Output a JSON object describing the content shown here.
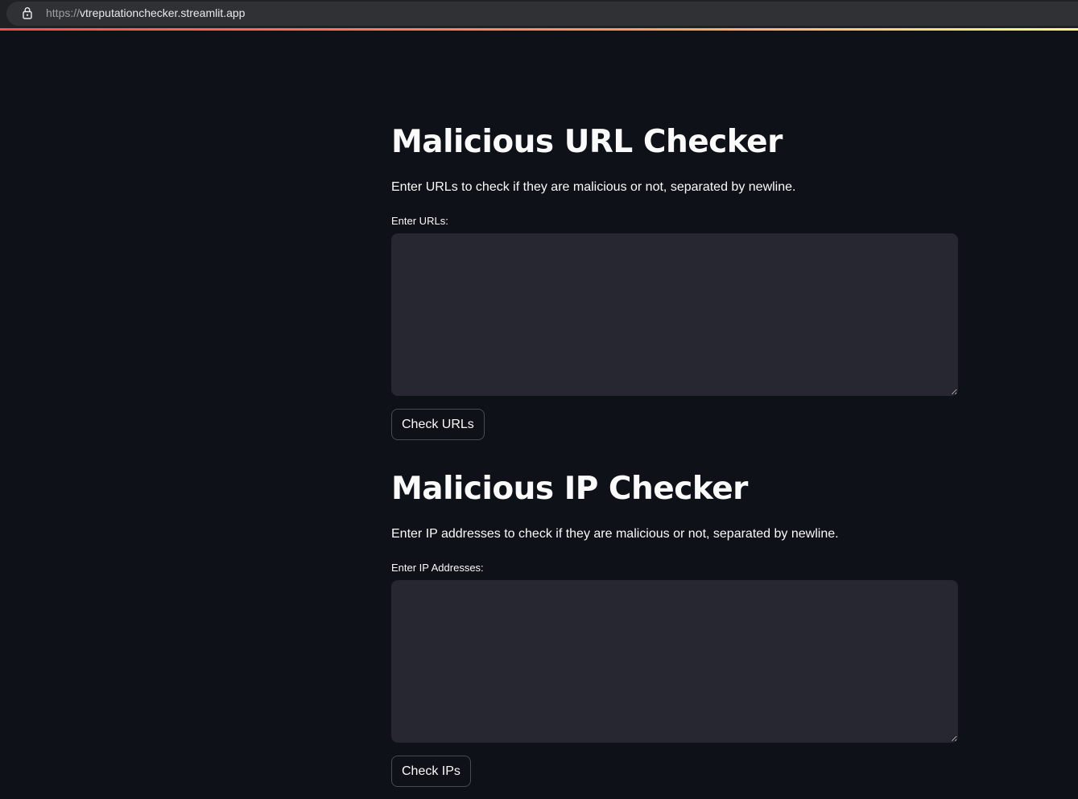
{
  "browser": {
    "url_scheme": "https://",
    "url_host": "vtreputationchecker.streamlit.app",
    "lock_icon": "lock-icon"
  },
  "url_section": {
    "title": "Malicious URL Checker",
    "description": "Enter URLs to check if they are malicious or not, separated by newline.",
    "input_label": "Enter URLs:",
    "input_value": "",
    "button_label": "Check URLs"
  },
  "ip_section": {
    "title": "Malicious IP Checker",
    "description": "Enter IP addresses to check if they are malicious or not, separated by newline.",
    "input_label": "Enter IP Addresses:",
    "input_value": "",
    "button_label": "Check IPs"
  },
  "colors": {
    "background": "#0e1117",
    "input_background": "#262730",
    "text": "#fafafa",
    "accent_start": "#ff4b4b",
    "accent_end": "#fffd80"
  }
}
